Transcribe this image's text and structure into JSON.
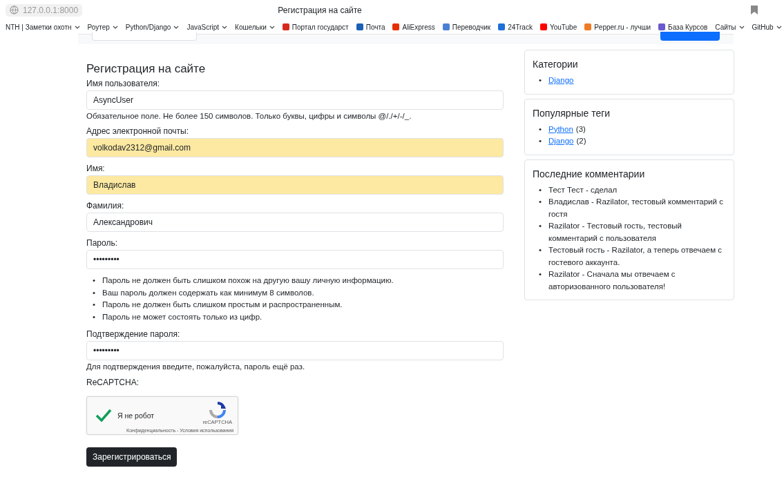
{
  "browser": {
    "address": "127.0.0.1:8000",
    "title": "Регистрация на сайте"
  },
  "bullet": "•",
  "bookmarks": [
    {
      "label": "NTH | Заметки охотн",
      "kind": "folder"
    },
    {
      "label": "Роутер",
      "kind": "folder"
    },
    {
      "label": "Python/Django",
      "kind": "folder"
    },
    {
      "label": "JavaScript",
      "kind": "folder"
    },
    {
      "label": "Кошельки",
      "kind": "folder"
    },
    {
      "label": "Портал государст",
      "kind": "link",
      "color": "#d52b1e"
    },
    {
      "label": "Почта",
      "kind": "link",
      "color": "#1a5fb4"
    },
    {
      "label": "AliExpress",
      "kind": "link",
      "color": "#e62e04"
    },
    {
      "label": "Переводчик",
      "kind": "link",
      "color": "#4a7fd6"
    },
    {
      "label": "24Track",
      "kind": "link",
      "color": "#1e6fd9"
    },
    {
      "label": "YouTube",
      "kind": "link",
      "color": "#ff0000"
    },
    {
      "label": "Pepper.ru - лучши",
      "kind": "link",
      "color": "#f07b22"
    },
    {
      "label": "База Курсов",
      "kind": "link",
      "color": "#6a5acd"
    },
    {
      "label": "Сайты",
      "kind": "folder"
    },
    {
      "label": "GitHub",
      "kind": "folder"
    }
  ],
  "form": {
    "title": "Регистрация на сайте",
    "fields": [
      {
        "label": "Имя пользователя:",
        "value": "AsyncUser",
        "autofilled": false,
        "help": "Обязательное поле. Не более 150 символов. Только буквы, цифры и символы @/./+/-/_."
      },
      {
        "label": "Адрес электронной почты:",
        "value": "volkodav2312@gmail.com",
        "autofilled": true
      },
      {
        "label": "Имя:",
        "value": "Владислав",
        "autofilled": true
      },
      {
        "label": "Фамилия:",
        "value": "Александрович",
        "autofilled": false
      },
      {
        "label": "Пароль:",
        "value": "•••••••••",
        "autofilled": false,
        "rules": [
          "Пароль не должен быть слишком похож на другую вашу личную информацию.",
          "Ваш пароль должен содержать как минимум 8 символов.",
          "Пароль не должен быть слишком простым и распространенным.",
          "Пароль не может состоять только из цифр."
        ]
      },
      {
        "label": "Подтверждение пароля:",
        "value": "•••••••••",
        "autofilled": false,
        "help": "Для подтверждения введите, пожалуйста, пароль ещё раз."
      }
    ],
    "captcha_label": "ReCAPTCHA:",
    "captcha": {
      "checked": true,
      "text": "Я не робот",
      "brand": "reCAPTCHA",
      "links": "Конфиденциальность - Условия использования"
    },
    "submit": "Зарегистрироваться"
  },
  "sidebar": [
    {
      "title": "Категории",
      "items": [
        {
          "link": "Django"
        }
      ]
    },
    {
      "title": "Популярные теги",
      "items": [
        {
          "link": "Python",
          "count": "(3)"
        },
        {
          "link": "Django",
          "count": "(2)"
        }
      ]
    },
    {
      "title": "Последние комментарии",
      "comments": [
        "Тест Тест - сделал",
        "Владислав - Razilator, тестовый комментарий с гостя",
        "Razilator - Тестовый гость, тестовый комментарий с пользователя",
        "Тестовый гость - Razilator, а теперь отвечаем с гостевого аккаунта.",
        "Razilator - Сначала мы отвечаем с авторизованного пользователя!"
      ]
    }
  ]
}
